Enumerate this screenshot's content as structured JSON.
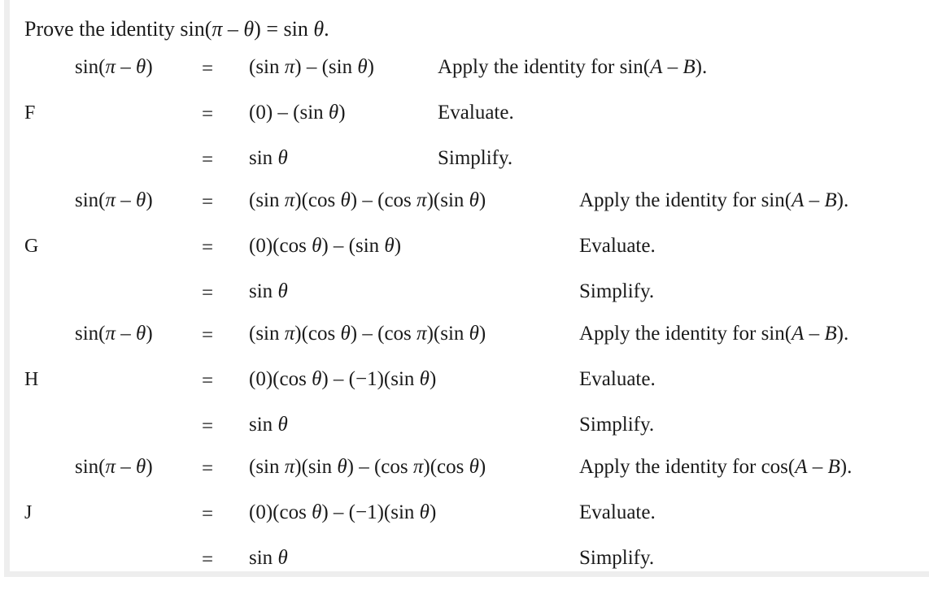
{
  "title": "Prove the identity sin(π – θ) = sin θ.",
  "options": [
    {
      "label": "F",
      "steps": [
        {
          "lhs": "sin(π – θ)",
          "eq": "=",
          "rhs": "(sin π) – (sin θ)",
          "reason": "Apply the identity for sin(A – B)."
        },
        {
          "lhs": "",
          "eq": "=",
          "rhs": "(0) – (sin θ)",
          "reason": "Evaluate."
        },
        {
          "lhs": "",
          "eq": "=",
          "rhs": "sin θ",
          "reason": "Simplify."
        }
      ]
    },
    {
      "label": "G",
      "steps": [
        {
          "lhs": "sin(π – θ)",
          "eq": "=",
          "rhs": "(sin π)(cos θ) – (cos π)(sin θ)",
          "reason": "Apply the identity for sin(A – B)."
        },
        {
          "lhs": "",
          "eq": "=",
          "rhs": "(0)(cos θ) – (sin θ)",
          "reason": "Evaluate."
        },
        {
          "lhs": "",
          "eq": "=",
          "rhs": "sin θ",
          "reason": "Simplify."
        }
      ]
    },
    {
      "label": "H",
      "steps": [
        {
          "lhs": "sin(π – θ)",
          "eq": "=",
          "rhs": "(sin π)(cos θ) – (cos π)(sin θ)",
          "reason": "Apply the identity for sin(A – B)."
        },
        {
          "lhs": "",
          "eq": "=",
          "rhs": "(0)(cos θ) – (−1)(sin θ)",
          "reason": "Evaluate."
        },
        {
          "lhs": "",
          "eq": "=",
          "rhs": "sin θ",
          "reason": "Simplify."
        }
      ]
    },
    {
      "label": "J",
      "steps": [
        {
          "lhs": "sin(π – θ)",
          "eq": "=",
          "rhs": "(sin π)(sin θ) – (cos π)(cos θ)",
          "reason": "Apply the identity for cos(A – B)."
        },
        {
          "lhs": "",
          "eq": "=",
          "rhs": "(0)(cos θ) – (−1)(sin θ)",
          "reason": "Evaluate."
        },
        {
          "lhs": "",
          "eq": "=",
          "rhs": "sin θ",
          "reason": "Simplify."
        }
      ]
    }
  ]
}
